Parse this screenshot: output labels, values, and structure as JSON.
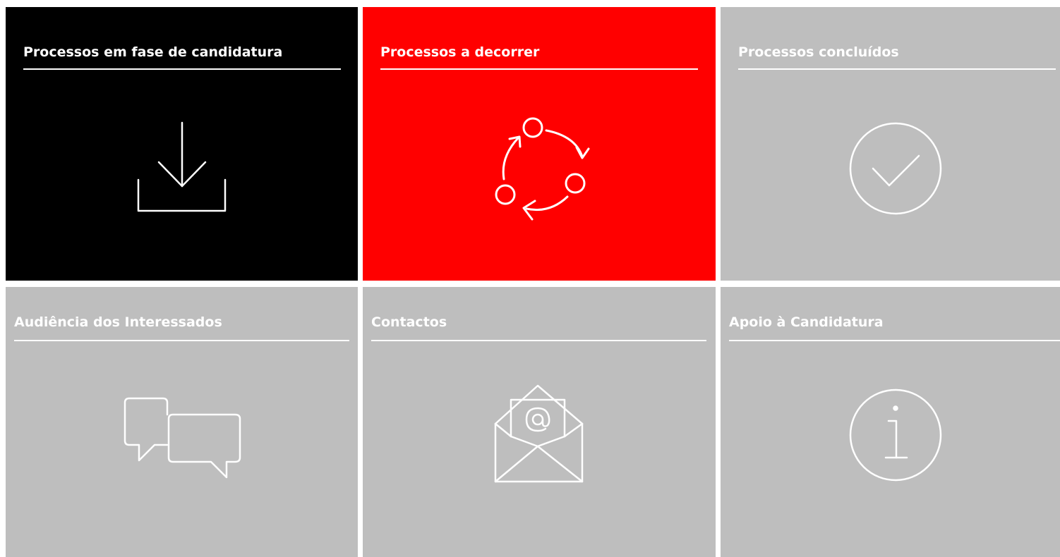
{
  "tiles": [
    {
      "id": "candidatura",
      "title": "Processos em fase de candidatura",
      "icon": "download-icon",
      "bg": "#000000"
    },
    {
      "id": "decorrer",
      "title": "Processos a decorrer",
      "icon": "cycle-icon",
      "bg": "#ff0000"
    },
    {
      "id": "concluidos",
      "title": "Processos concluídos",
      "icon": "check-circle-icon",
      "bg": "#bebebe"
    },
    {
      "id": "audiencia",
      "title": "Audiência dos Interessados",
      "icon": "chat-bubbles-icon",
      "bg": "#bebebe"
    },
    {
      "id": "contactos",
      "title": "Contactos",
      "icon": "envelope-at-icon",
      "bg": "#bebebe"
    },
    {
      "id": "apoio",
      "title": "Apoio à Candidatura",
      "icon": "info-circle-icon",
      "bg": "#bebebe"
    }
  ],
  "colors": {
    "black": "#000000",
    "red": "#ff0000",
    "grey": "#bebebe",
    "white": "#ffffff"
  }
}
